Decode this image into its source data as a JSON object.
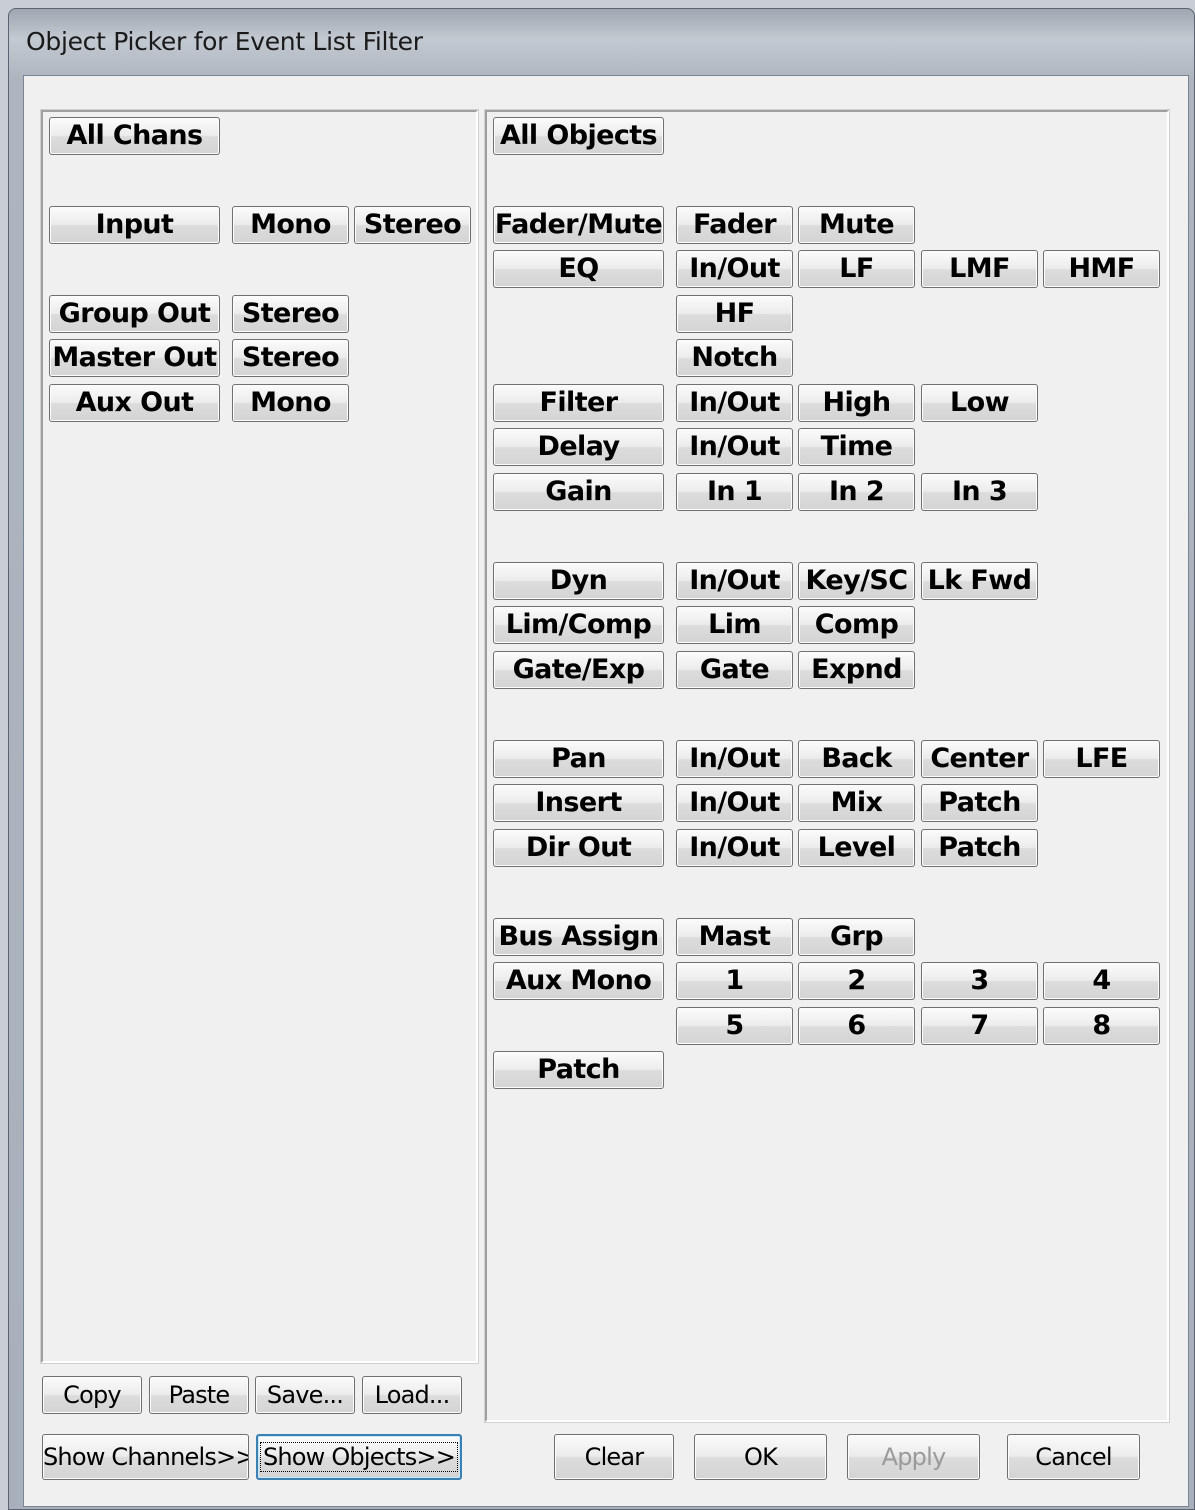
{
  "window": {
    "title": "Object Picker for Event List Filter"
  },
  "channels": {
    "all": "All Chans",
    "input": {
      "label": "Input",
      "mono": "Mono",
      "stereo": "Stereo"
    },
    "group_out": {
      "label": "Group Out",
      "stereo": "Stereo"
    },
    "master_out": {
      "label": "Master Out",
      "stereo": "Stereo"
    },
    "aux_out": {
      "label": "Aux Out",
      "mono": "Mono"
    }
  },
  "objects": {
    "all": "All Objects",
    "fader_mute": {
      "label": "Fader/Mute",
      "fader": "Fader",
      "mute": "Mute"
    },
    "eq": {
      "label": "EQ",
      "inout": "In/Out",
      "lf": "LF",
      "lmf": "LMF",
      "hmf": "HMF",
      "hf": "HF",
      "notch": "Notch"
    },
    "filter": {
      "label": "Filter",
      "inout": "In/Out",
      "high": "High",
      "low": "Low"
    },
    "delay": {
      "label": "Delay",
      "inout": "In/Out",
      "time": "Time"
    },
    "gain": {
      "label": "Gain",
      "in1": "In 1",
      "in2": "In 2",
      "in3": "In 3"
    },
    "dyn": {
      "label": "Dyn",
      "inout": "In/Out",
      "keysc": "Key/SC",
      "lkfwd": "Lk Fwd"
    },
    "limcomp": {
      "label": "Lim/Comp",
      "lim": "Lim",
      "comp": "Comp"
    },
    "gateexp": {
      "label": "Gate/Exp",
      "gate": "Gate",
      "expnd": "Expnd"
    },
    "pan": {
      "label": "Pan",
      "inout": "In/Out",
      "back": "Back",
      "center": "Center",
      "lfe": "LFE"
    },
    "insert": {
      "label": "Insert",
      "inout": "In/Out",
      "mix": "Mix",
      "patch": "Patch"
    },
    "dirout": {
      "label": "Dir Out",
      "inout": "In/Out",
      "level": "Level",
      "patch": "Patch"
    },
    "busassign": {
      "label": "Bus Assign",
      "mast": "Mast",
      "grp": "Grp"
    },
    "auxmono": {
      "label": "Aux Mono",
      "n1": "1",
      "n2": "2",
      "n3": "3",
      "n4": "4",
      "n5": "5",
      "n6": "6",
      "n7": "7",
      "n8": "8"
    },
    "patch": "Patch"
  },
  "footer": {
    "copy": "Copy",
    "paste": "Paste",
    "save": "Save...",
    "load": "Load...",
    "show_channels": "Show Channels>>",
    "show_objects": "Show Objects>>",
    "clear": "Clear",
    "ok": "OK",
    "apply": "Apply",
    "cancel": "Cancel"
  }
}
